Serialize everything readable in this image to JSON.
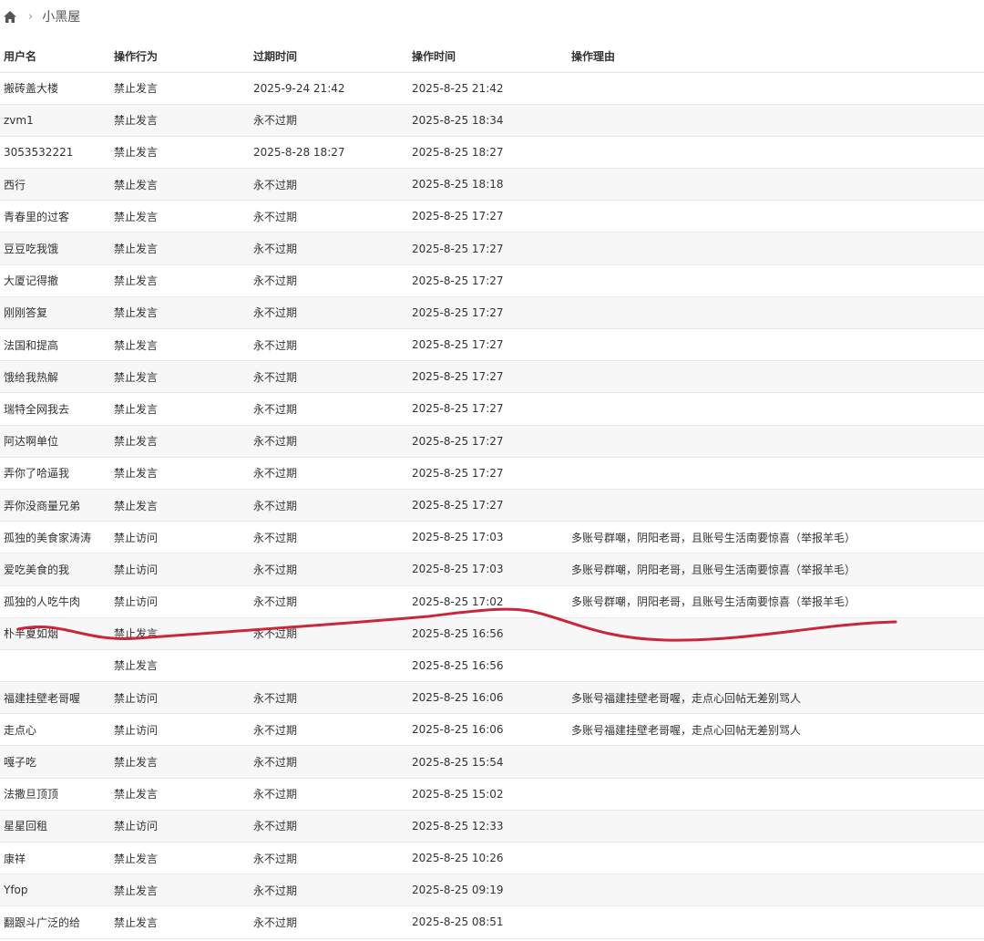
{
  "breadcrumb": {
    "current": "小黑屋"
  },
  "table": {
    "headers": [
      "用户名",
      "操作行为",
      "过期时间",
      "操作时间",
      "操作理由"
    ],
    "rows": [
      [
        "搬砖盖大楼",
        "禁止发言",
        "2025-9-24 21:42",
        "2025-8-25 21:42",
        ""
      ],
      [
        "zvm1",
        "禁止发言",
        "永不过期",
        "2025-8-25 18:34",
        ""
      ],
      [
        "3053532221",
        "禁止发言",
        "2025-8-28 18:27",
        "2025-8-25 18:27",
        ""
      ],
      [
        "西行",
        "禁止发言",
        "永不过期",
        "2025-8-25 18:18",
        ""
      ],
      [
        "青春里的过客",
        "禁止发言",
        "永不过期",
        "2025-8-25 17:27",
        ""
      ],
      [
        "豆豆吃我饿",
        "禁止发言",
        "永不过期",
        "2025-8-25 17:27",
        ""
      ],
      [
        "大厦记得撤",
        "禁止发言",
        "永不过期",
        "2025-8-25 17:27",
        ""
      ],
      [
        "刚刚答复",
        "禁止发言",
        "永不过期",
        "2025-8-25 17:27",
        ""
      ],
      [
        "法国和提高",
        "禁止发言",
        "永不过期",
        "2025-8-25 17:27",
        ""
      ],
      [
        "饿给我热解",
        "禁止发言",
        "永不过期",
        "2025-8-25 17:27",
        ""
      ],
      [
        "瑞特全网我去",
        "禁止发言",
        "永不过期",
        "2025-8-25 17:27",
        ""
      ],
      [
        "阿达啊单位",
        "禁止发言",
        "永不过期",
        "2025-8-25 17:27",
        ""
      ],
      [
        "弄你了哈逼我",
        "禁止发言",
        "永不过期",
        "2025-8-25 17:27",
        ""
      ],
      [
        "弄你没商量兄弟",
        "禁止发言",
        "永不过期",
        "2025-8-25 17:27",
        ""
      ],
      [
        "孤独的美食家涛涛",
        "禁止访问",
        "永不过期",
        "2025-8-25 17:03",
        "多账号群嘲，阴阳老哥，且账号生活南要惊喜（举报羊毛）"
      ],
      [
        "爱吃美食的我",
        "禁止访问",
        "永不过期",
        "2025-8-25 17:03",
        "多账号群嘲，阴阳老哥，且账号生活南要惊喜（举报羊毛）"
      ],
      [
        "孤独的人吃牛肉",
        "禁止访问",
        "永不过期",
        "2025-8-25 17:02",
        "多账号群嘲，阴阳老哥，且账号生活南要惊喜（举报羊毛）"
      ],
      [
        "朴半夏如烟",
        "禁止发言",
        "永不过期",
        "2025-8-25 16:56",
        ""
      ],
      [
        "",
        "禁止发言",
        "",
        "2025-8-25 16:56",
        ""
      ],
      [
        "福建挂壁老哥喔",
        "禁止访问",
        "永不过期",
        "2025-8-25 16:06",
        "多账号福建挂壁老哥喔，走点心回帖无差别骂人"
      ],
      [
        "走点心",
        "禁止访问",
        "永不过期",
        "2025-8-25 16:06",
        "多账号福建挂壁老哥喔，走点心回帖无差别骂人"
      ],
      [
        "嘎子吃",
        "禁止发言",
        "永不过期",
        "2025-8-25 15:54",
        ""
      ],
      [
        "法撒旦顶顶",
        "禁止发言",
        "永不过期",
        "2025-8-25 15:02",
        ""
      ],
      [
        "星星回租",
        "禁止访问",
        "永不过期",
        "2025-8-25 12:33",
        ""
      ],
      [
        "康祥",
        "禁止发言",
        "永不过期",
        "2025-8-25 10:26",
        ""
      ],
      [
        "Yfop",
        "禁止发言",
        "永不过期",
        "2025-8-25 09:19",
        ""
      ],
      [
        "翻跟斗广泛的给",
        "禁止发言",
        "永不过期",
        "2025-8-25 08:51",
        ""
      ]
    ]
  },
  "colors": {
    "scribble": "#c8283a",
    "header_text": "#333333",
    "row_alt": "#f7f7f7"
  }
}
